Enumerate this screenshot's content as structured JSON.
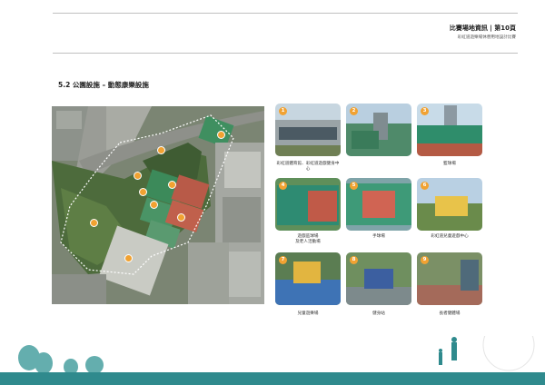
{
  "header": {
    "title": "比賽場地資訊 | 第10頁",
    "subtitle": "彩虹道遊樂場休憩用地設計比賽"
  },
  "section": {
    "title": "5.2 公園設施 – 動態康樂設施"
  },
  "map": {
    "markers": [
      "1",
      "2",
      "3",
      "4",
      "5",
      "6",
      "7",
      "8",
      "9"
    ]
  },
  "photos": [
    {
      "num": "1",
      "caption": "彩虹道體育館、彩虹道遊戲健身中心"
    },
    {
      "num": "2",
      "caption": ""
    },
    {
      "num": "3",
      "caption": "籃球場"
    },
    {
      "num": "4",
      "caption": "遊戲區球場\n及老人活動場"
    },
    {
      "num": "5",
      "caption": "手球場"
    },
    {
      "num": "6",
      "caption": "彩虹道兒童遊戲中心"
    },
    {
      "num": "7",
      "caption": "兒童遊樂場"
    },
    {
      "num": "8",
      "caption": "健身站"
    },
    {
      "num": "9",
      "caption": "長者健體場"
    }
  ],
  "colors": {
    "accent": "#f1a232",
    "footer": "#2f8a8d"
  }
}
